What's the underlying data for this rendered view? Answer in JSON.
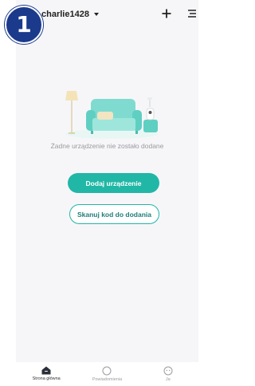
{
  "badge": {
    "number": "1"
  },
  "header": {
    "home_name": "charlie1428",
    "icons": [
      "plus-icon",
      "menu-icon"
    ]
  },
  "empty_state": {
    "message": "Żadne urządzenie nie zostało dodane",
    "primary_button": "Dodaj urządzenie",
    "secondary_button": "Skanuj kod do dodania"
  },
  "bottom_nav": {
    "items": [
      {
        "label": "Strona główna",
        "icon": "home-icon",
        "active": true
      },
      {
        "label": "Powiadomienia",
        "icon": "bell-icon",
        "active": false
      },
      {
        "label": "Ja",
        "icon": "profile-icon",
        "active": false
      }
    ]
  },
  "colors": {
    "accent": "#21b7a6",
    "badge": "#1b3a8c",
    "background": "#f6f6f8"
  }
}
